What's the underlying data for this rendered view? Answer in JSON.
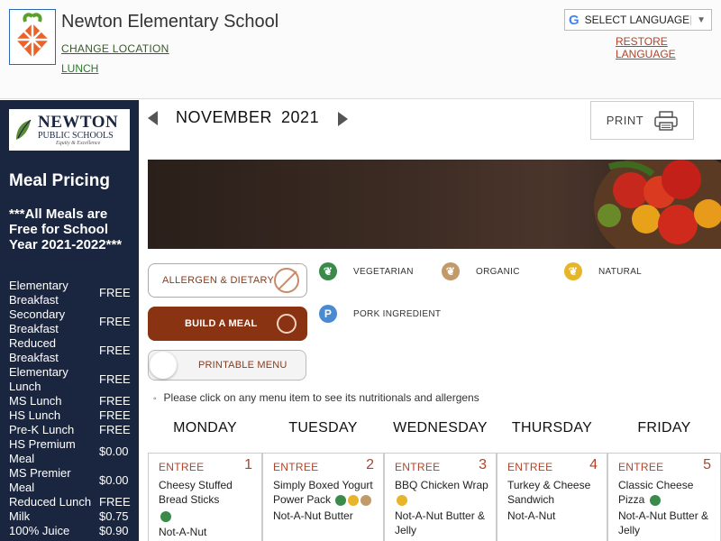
{
  "header": {
    "school_name": "Newton Elementary School",
    "change_location": "CHANGE LOCATION",
    "lunch": "LUNCH",
    "language_select": "SELECT LANGUAGE",
    "restore_language": "RESTORE LANGUAGE"
  },
  "sidebar": {
    "logo_line1": "NEWTON",
    "logo_line2": "PUBLIC SCHOOLS",
    "logo_line3": "Equity & Excellence",
    "meal_pricing_title": "Meal Pricing",
    "free_note": "***All Meals are Free for School Year 2021-2022***",
    "prices": [
      {
        "label": "Elementary Breakfast",
        "value": "FREE"
      },
      {
        "label": "Secondary Breakfast",
        "value": "FREE"
      },
      {
        "label": "Reduced Breakfast",
        "value": "FREE"
      },
      {
        "label": "Elementary Lunch",
        "value": "FREE"
      },
      {
        "label": "MS Lunch",
        "value": "FREE"
      },
      {
        "label": "HS Lunch",
        "value": "FREE"
      },
      {
        "label": "Pre-K Lunch",
        "value": "FREE"
      },
      {
        "label": "HS Premium Meal",
        "value": "$0.00"
      },
      {
        "label": "MS Premier Meal",
        "value": "$0.00"
      },
      {
        "label": "Reduced Lunch",
        "value": "FREE"
      },
      {
        "label": "Milk",
        "value": "$0.75"
      },
      {
        "label": "100% Juice",
        "value": "$0.90"
      }
    ]
  },
  "calendar_nav": {
    "month": "NOVEMBER",
    "year": "2021",
    "print_label": "PRINT"
  },
  "actions": {
    "allergen": "ALLERGEN & DIETARY",
    "build_meal": "BUILD A MEAL",
    "printable_menu": "PRINTABLE MENU"
  },
  "legend": {
    "vegetarian": "VEGETARIAN",
    "organic": "ORGANIC",
    "natural": "NATURAL",
    "pork": "PORK INGREDIENT",
    "pork_icon_letter": "P"
  },
  "note": "Please click on any menu item to see its nutritionals and allergens",
  "days": [
    {
      "name": "MONDAY",
      "num": "1",
      "category": "ENTREE",
      "items": [
        "Cheesy Stuffed Bread Sticks",
        "",
        "Not-A-Nut"
      ]
    },
    {
      "name": "TUESDAY",
      "num": "2",
      "category": "ENTREE",
      "items": [
        "Simply Boxed Yogurt Power Pack",
        "Not-A-Nut Butter"
      ]
    },
    {
      "name": "WEDNESDAY",
      "num": "3",
      "category": "ENTREE",
      "items": [
        "BBQ Chicken Wrap",
        "Not-A-Nut Butter & Jelly"
      ]
    },
    {
      "name": "THURSDAY",
      "num": "4",
      "category": "ENTREE",
      "items": [
        "Turkey & Cheese Sandwich",
        "Not-A-Nut"
      ]
    },
    {
      "name": "FRIDAY",
      "num": "5",
      "category": "ENTREE",
      "items": [
        "Classic Cheese Pizza",
        "Not-A-Nut Butter & Jelly"
      ]
    }
  ],
  "colors": {
    "sidebar_bg": "#1a2640",
    "accent": "#b0442a",
    "build_meal_bg": "#8a3312",
    "vegetarian": "#3a8a4a",
    "natural": "#e8b52a",
    "organic": "#c29a6a",
    "pork": "#4a8ad0"
  }
}
